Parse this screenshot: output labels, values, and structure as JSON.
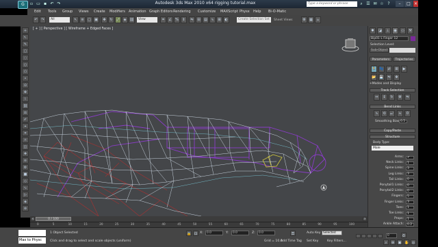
{
  "window": {
    "title": "Autodesk 3ds Max 2010 x64     rigging tutorial.max",
    "search_placeholder": "Type a keyword or phrase",
    "logo_glyph": "G"
  },
  "menu": [
    "Edit",
    "Tools",
    "Group",
    "Views",
    "Create",
    "Modifiers",
    "Animation",
    "Graph Editors",
    "Rendering",
    "Customize",
    "MAXScript",
    "Physx",
    "Help",
    "Bi-O-Matic"
  ],
  "toolbar": {
    "selection_filter": "All",
    "ref_coord": "View",
    "named_selection": "Create Selection Set",
    "create_label": "Sheet Views"
  },
  "viewport": {
    "label": "[ + ] [ Perspective ] [ Wireframe + Edged Faces ]",
    "background": "#444649"
  },
  "command_panel": {
    "object_name": "Bip01 L Finger 12",
    "selection_level_label": "Selection Level:",
    "sub_object_value": "Sub-Object",
    "buttons": [
      "Parameters",
      "Trajectories"
    ],
    "modes_label": "+Modes and Display",
    "track_selection_label": "Track Selection",
    "bend_links_label": "Bend Links",
    "smoothing_bias_label": "Smoothing Bias:",
    "smoothing_bias_value": "0.5",
    "copy_paste_label": "Copy/Paste",
    "structure_label": "Structure",
    "body_type_label": "Body Type:",
    "body_type_value": "Male",
    "structure_rows": [
      {
        "label": "Arms:",
        "value": "✔"
      },
      {
        "label": "Neck Links:",
        "value": "1"
      },
      {
        "label": "Spine Links:",
        "value": "3"
      },
      {
        "label": "Leg Links:",
        "value": "3"
      },
      {
        "label": "Tail Links:",
        "value": "0"
      },
      {
        "label": "Ponytail1 Links:",
        "value": "0"
      },
      {
        "label": "Ponytail2 Links:",
        "value": "0"
      },
      {
        "label": "Fingers:",
        "value": "5"
      },
      {
        "label": "Finger Links:",
        "value": "3"
      },
      {
        "label": "Toes:",
        "value": "1"
      },
      {
        "label": "Toe Links:",
        "value": "1"
      },
      {
        "label": "Props:",
        "value": "1"
      },
      {
        "label": "Ankle Attach:",
        "value": "0.2"
      }
    ]
  },
  "timeline": {
    "slider_label": "0 / 100",
    "ticks": [
      "0",
      "5",
      "10",
      "15",
      "20",
      "25",
      "30",
      "35",
      "40",
      "45",
      "50",
      "55",
      "60",
      "65",
      "70",
      "75",
      "80",
      "85",
      "90",
      "95",
      "100"
    ]
  },
  "status": {
    "maxscript_text": "Max to Physc",
    "line1": "1 Object Selected",
    "line2": "Click and drag to select and scale objects (uniform)",
    "x_label": "X:",
    "x_value": "0.0",
    "y_label": "Y:",
    "y_value": "0.0",
    "z_label": "Z:",
    "z_value": "0.0",
    "grid": "Grid = 10.0",
    "auto_key": "Auto Key",
    "set_key": "Set Key",
    "key_mode": "Selected",
    "add_time_tag": "Add Time Tag",
    "key_filters": "Key Filters...",
    "frame": "0"
  },
  "colors": {
    "mesh_white": "#d8e4f0",
    "mesh_purple": "#8a3cc8",
    "mesh_red": "#b03030",
    "mesh_yellow": "#c8c040"
  }
}
